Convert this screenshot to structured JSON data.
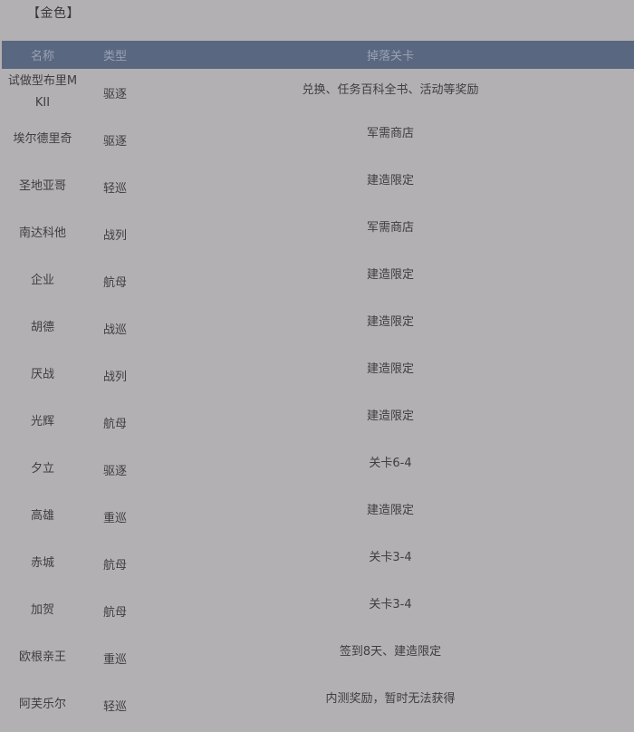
{
  "section_title": "【金色】",
  "table": {
    "headers": {
      "name": "名称",
      "type": "类型",
      "drop": "掉落关卡"
    },
    "rows": [
      {
        "name": "试做型布里MKII",
        "type": "驱逐",
        "drop": "兑换、任务百科全书、活动等奖励"
      },
      {
        "name": "埃尔德里奇",
        "type": "驱逐",
        "drop": "军需商店"
      },
      {
        "name": "圣地亚哥",
        "type": "轻巡",
        "drop": "建造限定"
      },
      {
        "name": "南达科他",
        "type": "战列",
        "drop": "军需商店"
      },
      {
        "name": "企业",
        "type": "航母",
        "drop": "建造限定"
      },
      {
        "name": "胡德",
        "type": "战巡",
        "drop": "建造限定"
      },
      {
        "name": "厌战",
        "type": "战列",
        "drop": "建造限定"
      },
      {
        "name": "光辉",
        "type": "航母",
        "drop": "建造限定"
      },
      {
        "name": "夕立",
        "type": "驱逐",
        "drop": "关卡6-4"
      },
      {
        "name": "高雄",
        "type": "重巡",
        "drop": "建造限定"
      },
      {
        "name": "赤城",
        "type": "航母",
        "drop": "关卡3-4"
      },
      {
        "name": "加贺",
        "type": "航母",
        "drop": "关卡3-4"
      },
      {
        "name": "欧根亲王",
        "type": "重巡",
        "drop": "签到8天、建造限定"
      },
      {
        "name": "阿芙乐尔",
        "type": "轻巡",
        "drop": "内测奖励，暂时无法获得"
      }
    ]
  }
}
